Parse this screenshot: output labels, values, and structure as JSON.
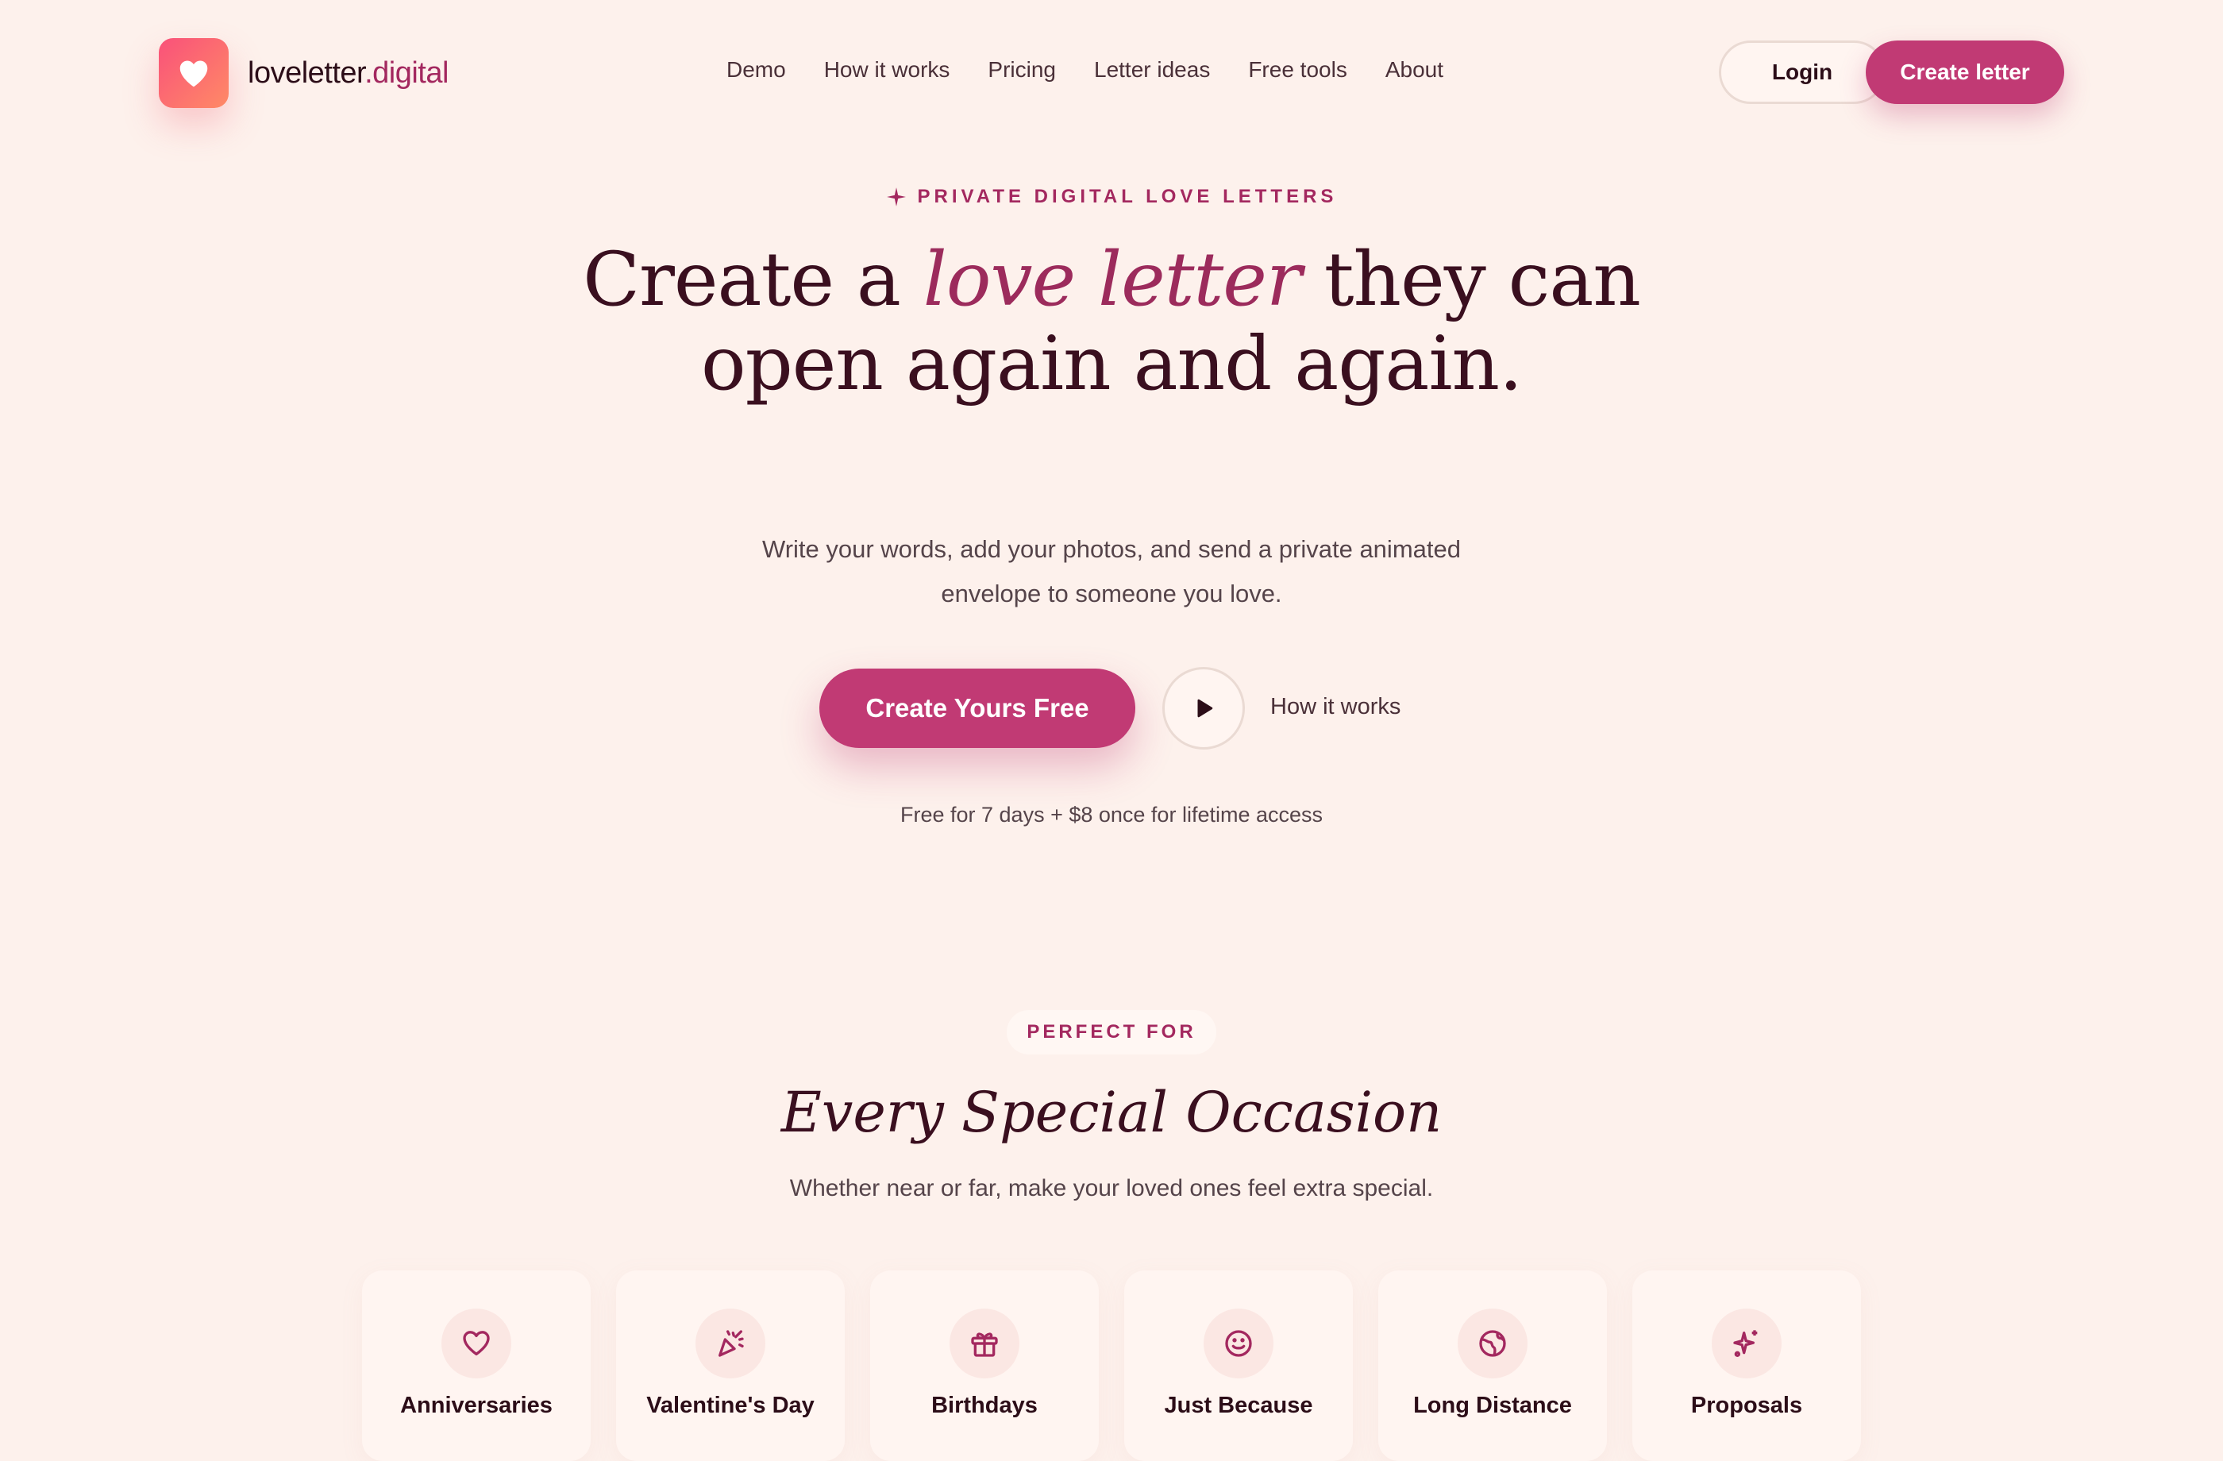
{
  "header": {
    "brand_part1": "loveletter",
    "brand_part2": ".digital",
    "nav": [
      "Demo",
      "How it works",
      "Pricing",
      "Letter ideas",
      "Free tools",
      "About"
    ],
    "login_label": "Login",
    "create_label": "Create letter"
  },
  "hero": {
    "eyebrow": "PRIVATE DIGITAL LOVE LETTERS",
    "title_pre": "Create a ",
    "title_emph": "love letter",
    "title_post": " they can open again and again.",
    "subtitle": "Write your words, add your photos, and send a private animated envelope to someone you love.",
    "cta_primary": "Create Yours Free",
    "cta_secondary": "How it works",
    "pricing_note": "Free for 7 days + $8 once for lifetime access"
  },
  "occasions": {
    "badge": "PERFECT FOR",
    "title": "Every Special Occasion",
    "subtitle": "Whether near or far, make your loved ones feel extra special.",
    "items": [
      {
        "label": "Anniversaries",
        "icon": "heart-icon"
      },
      {
        "label": "Valentine's Day",
        "icon": "party-popper-icon"
      },
      {
        "label": "Birthdays",
        "icon": "gift-icon"
      },
      {
        "label": "Just Because",
        "icon": "smile-icon"
      },
      {
        "label": "Long Distance",
        "icon": "globe-icon"
      },
      {
        "label": "Proposals",
        "icon": "sparkles-icon"
      }
    ]
  },
  "colors": {
    "background": "#fdf1ec",
    "accent": "#c13a74",
    "accent_text": "#a3285f",
    "heading": "#3a0f1f"
  }
}
